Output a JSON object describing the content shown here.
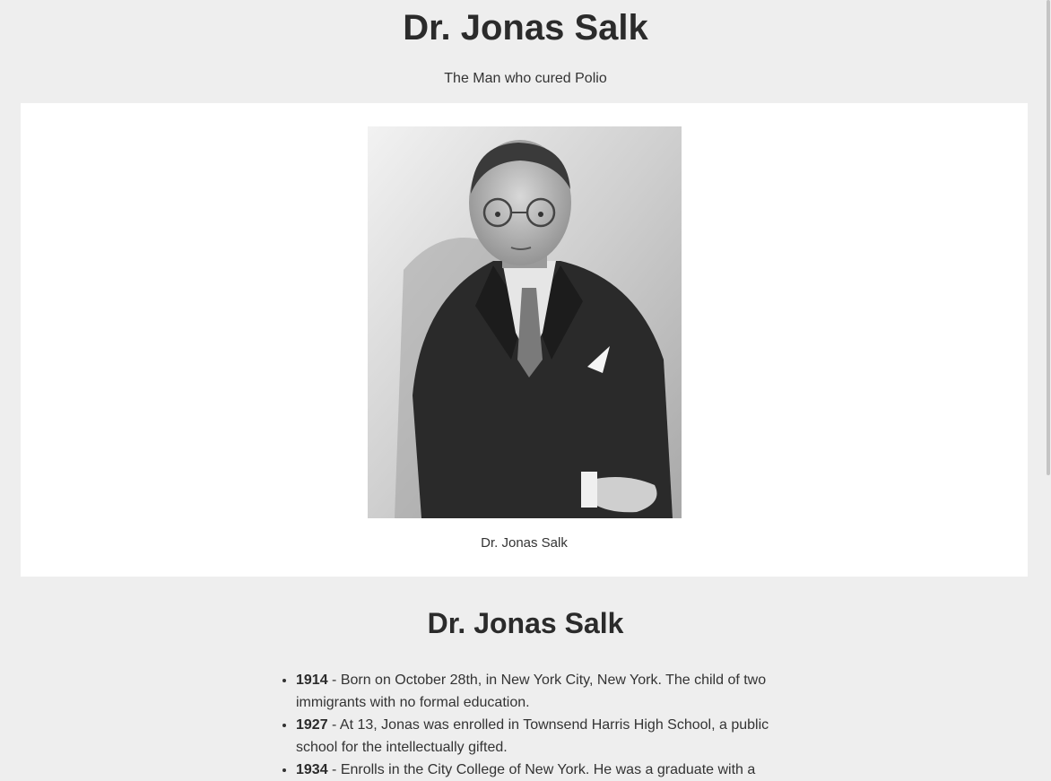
{
  "header": {
    "title": "Dr. Jonas Salk",
    "tagline": "The Man who cured Polio"
  },
  "image_panel": {
    "photo_alt": "Dr. Jonas Salk",
    "caption": "Dr. Jonas Salk"
  },
  "tribute": {
    "heading": "Dr. Jonas Salk",
    "timeline": [
      {
        "year": "1914",
        "text": " - Born on October 28th, in New York City, New York. The child of two immigrants with no formal education."
      },
      {
        "year": "1927",
        "text": " - At 13, Jonas was enrolled in Townsend Harris High School, a public school for the intellectually gifted."
      },
      {
        "year": "1934",
        "text": " - Enrolls in the City College of New York. He was a graduate with a"
      }
    ]
  }
}
